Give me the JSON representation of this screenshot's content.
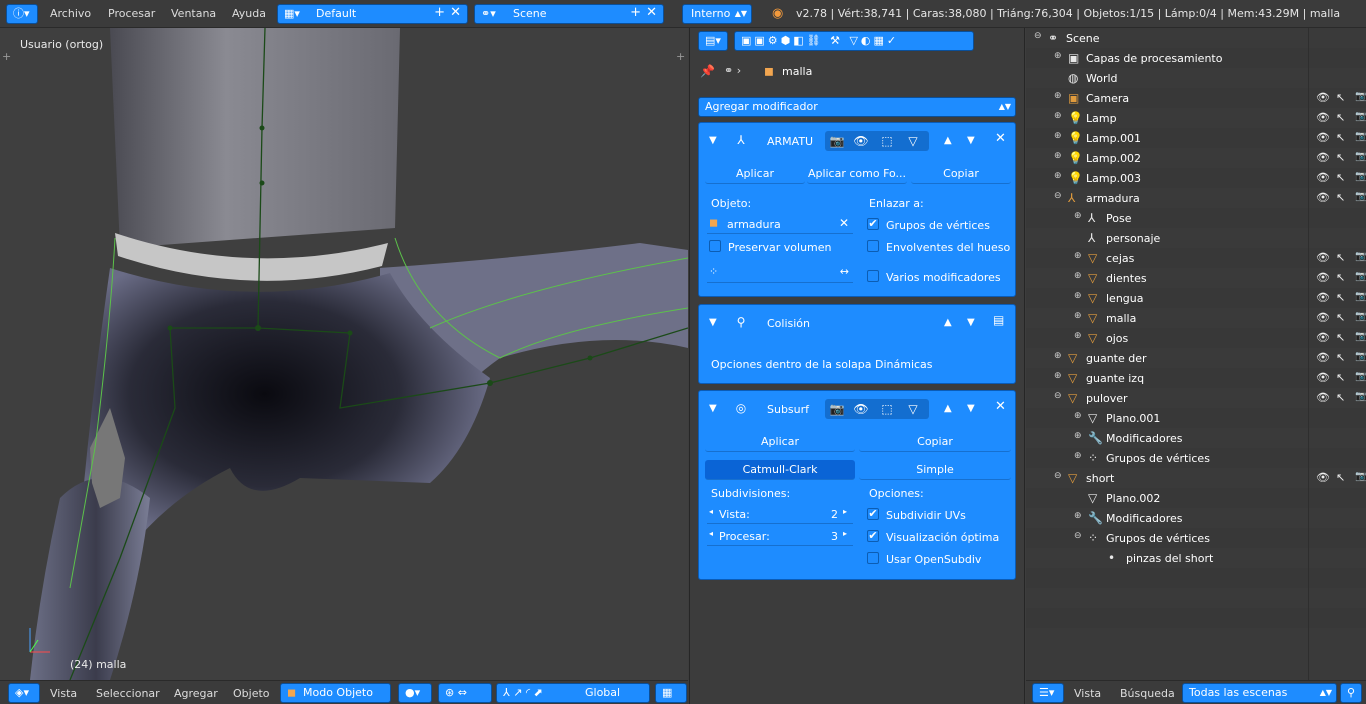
{
  "topbar": {
    "menus": [
      "Archivo",
      "Procesar",
      "Ventana",
      "Ayuda"
    ],
    "layout": "Default",
    "scene": "Scene",
    "engine": "Interno",
    "stats": "v2.78 | Vért:38,741 | Caras:38,080 | Triáng:76,304 | Objetos:1/15 | Lámp:0/4 | Mem:43.29M | malla"
  },
  "viewport": {
    "view_label": "Usuario (ortog)",
    "object_label": "(24) malla",
    "menus": [
      "Vista",
      "Seleccionar",
      "Agregar",
      "Objeto"
    ],
    "mode": "Modo Objeto",
    "orientation": "Global"
  },
  "props": {
    "context_object": "malla",
    "add_modifier": "Agregar modificador",
    "armature": {
      "name": "ARMATU",
      "apply": "Aplicar",
      "apply_shape": "Aplicar como Fo...",
      "copy": "Copiar",
      "object_label": "Objeto:",
      "object_value": "armadura",
      "bind_label": "Enlazar a:",
      "vertex_groups": "Grupos de vértices",
      "preserve_volume": "Preservar volumen",
      "bone_envelopes": "Envolventes del hueso",
      "multi_modifier": "Varios modificadores"
    },
    "collision": {
      "name": "Colisión",
      "info": "Opciones dentro de la solapa Dinámicas"
    },
    "subsurf": {
      "name": "Subsurf",
      "apply": "Aplicar",
      "copy": "Copiar",
      "catmull": "Catmull-Clark",
      "simple": "Simple",
      "subdiv_label": "Subdivisiones:",
      "view_label": "Vista:",
      "view_value": "2",
      "render_label": "Procesar:",
      "render_value": "3",
      "options_label": "Opciones:",
      "subdiv_uvs": "Subdividir UVs",
      "optimal_display": "Visualización óptima",
      "use_opensubdiv": "Usar OpenSubdiv"
    }
  },
  "outliner": {
    "rows": [
      {
        "label": "Scene",
        "indent": 0,
        "icon": "scene-icon",
        "expand": "minus",
        "vis": false
      },
      {
        "label": "Capas de procesamiento",
        "indent": 1,
        "icon": "layers-icon",
        "expand": "plus",
        "vis": false
      },
      {
        "label": "World",
        "indent": 1,
        "icon": "world-icon",
        "expand": "",
        "vis": false
      },
      {
        "label": "Camera",
        "indent": 1,
        "icon": "camera-icon",
        "expand": "plus",
        "vis": true
      },
      {
        "label": "Lamp",
        "indent": 1,
        "icon": "lamp-icon",
        "expand": "plus",
        "vis": true
      },
      {
        "label": "Lamp.001",
        "indent": 1,
        "icon": "lamp-icon",
        "expand": "plus",
        "vis": true
      },
      {
        "label": "Lamp.002",
        "indent": 1,
        "icon": "lamp-icon",
        "expand": "plus",
        "vis": true
      },
      {
        "label": "Lamp.003",
        "indent": 1,
        "icon": "lamp-icon",
        "expand": "plus",
        "vis": true
      },
      {
        "label": "armadura",
        "indent": 1,
        "icon": "armature-icon",
        "expand": "minus",
        "vis": true
      },
      {
        "label": "Pose",
        "indent": 2,
        "icon": "pose-icon",
        "expand": "plus",
        "vis": false
      },
      {
        "label": "personaje",
        "indent": 2,
        "icon": "armature-data-icon",
        "expand": "",
        "vis": false
      },
      {
        "label": "cejas",
        "indent": 2,
        "icon": "mesh-icon",
        "expand": "plus",
        "vis": true
      },
      {
        "label": "dientes",
        "indent": 2,
        "icon": "mesh-icon",
        "expand": "plus",
        "vis": true
      },
      {
        "label": "lengua",
        "indent": 2,
        "icon": "mesh-icon",
        "expand": "plus",
        "vis": true
      },
      {
        "label": "malla",
        "indent": 2,
        "icon": "mesh-icon",
        "expand": "plus",
        "vis": true
      },
      {
        "label": "ojos",
        "indent": 2,
        "icon": "mesh-icon",
        "expand": "plus",
        "vis": true
      },
      {
        "label": "guante der",
        "indent": 1,
        "icon": "mesh-icon",
        "expand": "plus",
        "vis": true
      },
      {
        "label": "guante izq",
        "indent": 1,
        "icon": "mesh-icon",
        "expand": "plus",
        "vis": true
      },
      {
        "label": "pulover",
        "indent": 1,
        "icon": "mesh-icon",
        "expand": "minus",
        "vis": true
      },
      {
        "label": "Plano.001",
        "indent": 2,
        "icon": "mesh-data-icon",
        "expand": "plus",
        "vis": false
      },
      {
        "label": "Modificadores",
        "indent": 2,
        "icon": "wrench-icon",
        "expand": "plus",
        "vis": false
      },
      {
        "label": "Grupos de vértices",
        "indent": 2,
        "icon": "vertex-group-icon",
        "expand": "plus",
        "vis": false
      },
      {
        "label": "short",
        "indent": 1,
        "icon": "mesh-icon",
        "expand": "minus",
        "vis": true
      },
      {
        "label": "Plano.002",
        "indent": 2,
        "icon": "mesh-data-icon",
        "expand": "",
        "vis": false
      },
      {
        "label": "Modificadores",
        "indent": 2,
        "icon": "wrench-icon",
        "expand": "plus",
        "vis": false
      },
      {
        "label": "Grupos de vértices",
        "indent": 2,
        "icon": "vertex-group-icon",
        "expand": "minus",
        "vis": false
      },
      {
        "label": "pinzas del short",
        "indent": 3,
        "icon": "dot-icon",
        "expand": "",
        "vis": false
      }
    ],
    "bottom_menus": [
      "Vista",
      "Búsqueda"
    ],
    "filter": "Todas las escenas"
  }
}
